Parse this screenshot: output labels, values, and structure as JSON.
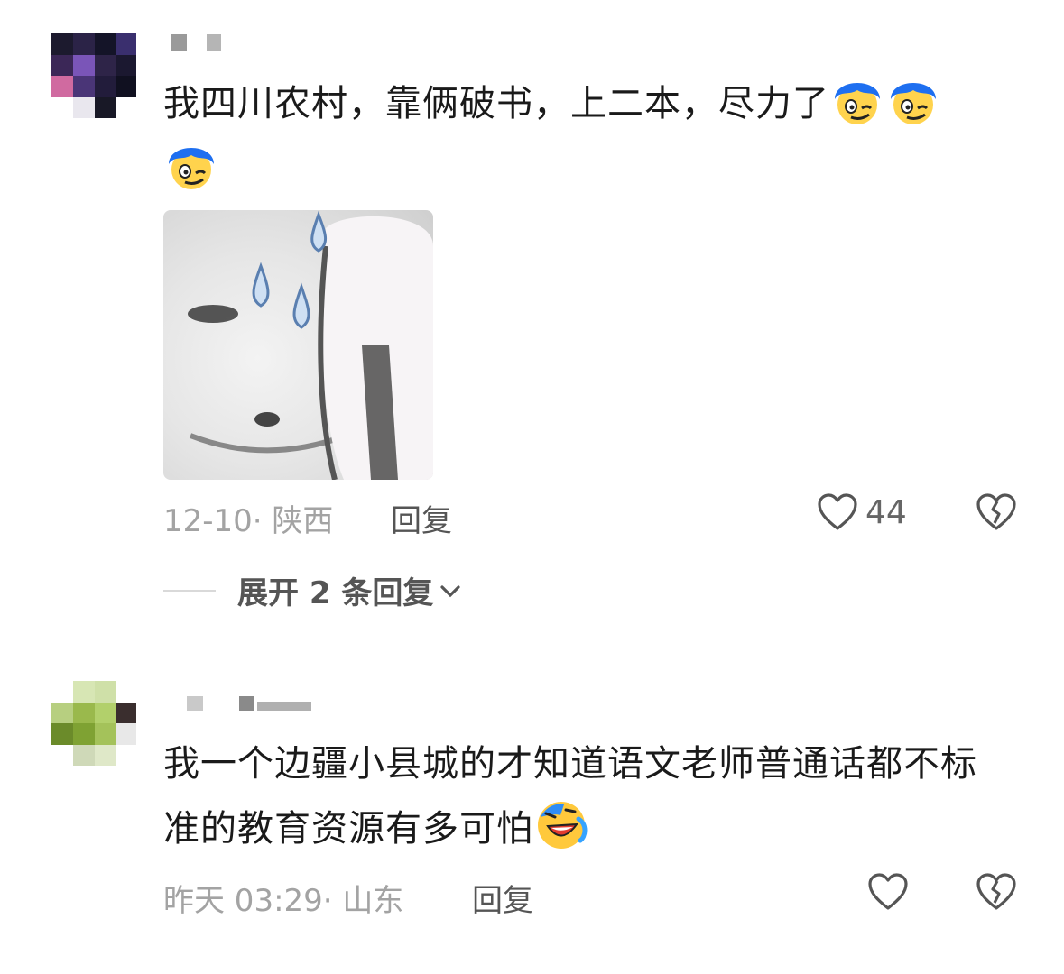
{
  "comments": [
    {
      "text": "我四川农村，靠俩破书，上二本，尽力了",
      "emojis": [
        "blue-hair-face-emoji",
        "blue-hair-face-emoji",
        "blue-hair-face-emoji"
      ],
      "date": "12-10",
      "location": "陕西",
      "reply_label": "回复",
      "likes": "44",
      "expand_label": "展开 2 条回复",
      "has_sticker": true
    },
    {
      "text": "我一个边疆小县城的才知道语文老师普通话都不标准的教育资源有多可怕",
      "emojis": [
        "laughing-crying-emoji"
      ],
      "date": "昨天 03:29",
      "location": "山东",
      "reply_label": "回复",
      "likes": ""
    }
  ],
  "colors": {
    "text": "#1a1a1a",
    "meta": "#a3a3a3",
    "action": "#555555",
    "icon": "#555555"
  },
  "icons": {
    "like": "heart-outline-icon",
    "dislike": "broken-heart-icon",
    "expand": "chevron-down-icon"
  }
}
